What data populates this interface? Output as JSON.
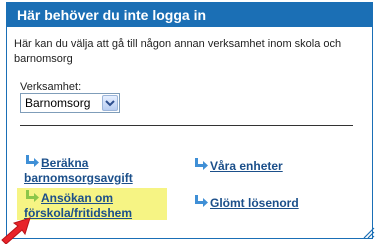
{
  "header": {
    "title": "Här behöver du inte logga in"
  },
  "intro": {
    "text": "Här kan du välja att gå till någon annan verksamhet inom skola och barnomsorg"
  },
  "verksamhet": {
    "label": "Verksamhet:",
    "selected": "Barnomsorg"
  },
  "links": {
    "berakna": {
      "line1": "Beräkna",
      "line2": "barnomsorgsavgift"
    },
    "enheter": {
      "text": "Våra enheter"
    },
    "ansokan": {
      "line1": "Ansökan om",
      "line2": "förskola/fritidshem"
    },
    "glomt": {
      "text": "Glömt lösenord"
    }
  },
  "colors": {
    "header_bg": "#1b6fb5",
    "link": "#1b4f8a",
    "arrow": "#3f8fd6",
    "highlight": "#f6f484",
    "pointer": "#e8232a"
  },
  "icons": {
    "link_arrow": "bent-arrow-icon",
    "dropdown": "chevron-down-icon",
    "pointer": "red-arrow-pointer-icon"
  }
}
